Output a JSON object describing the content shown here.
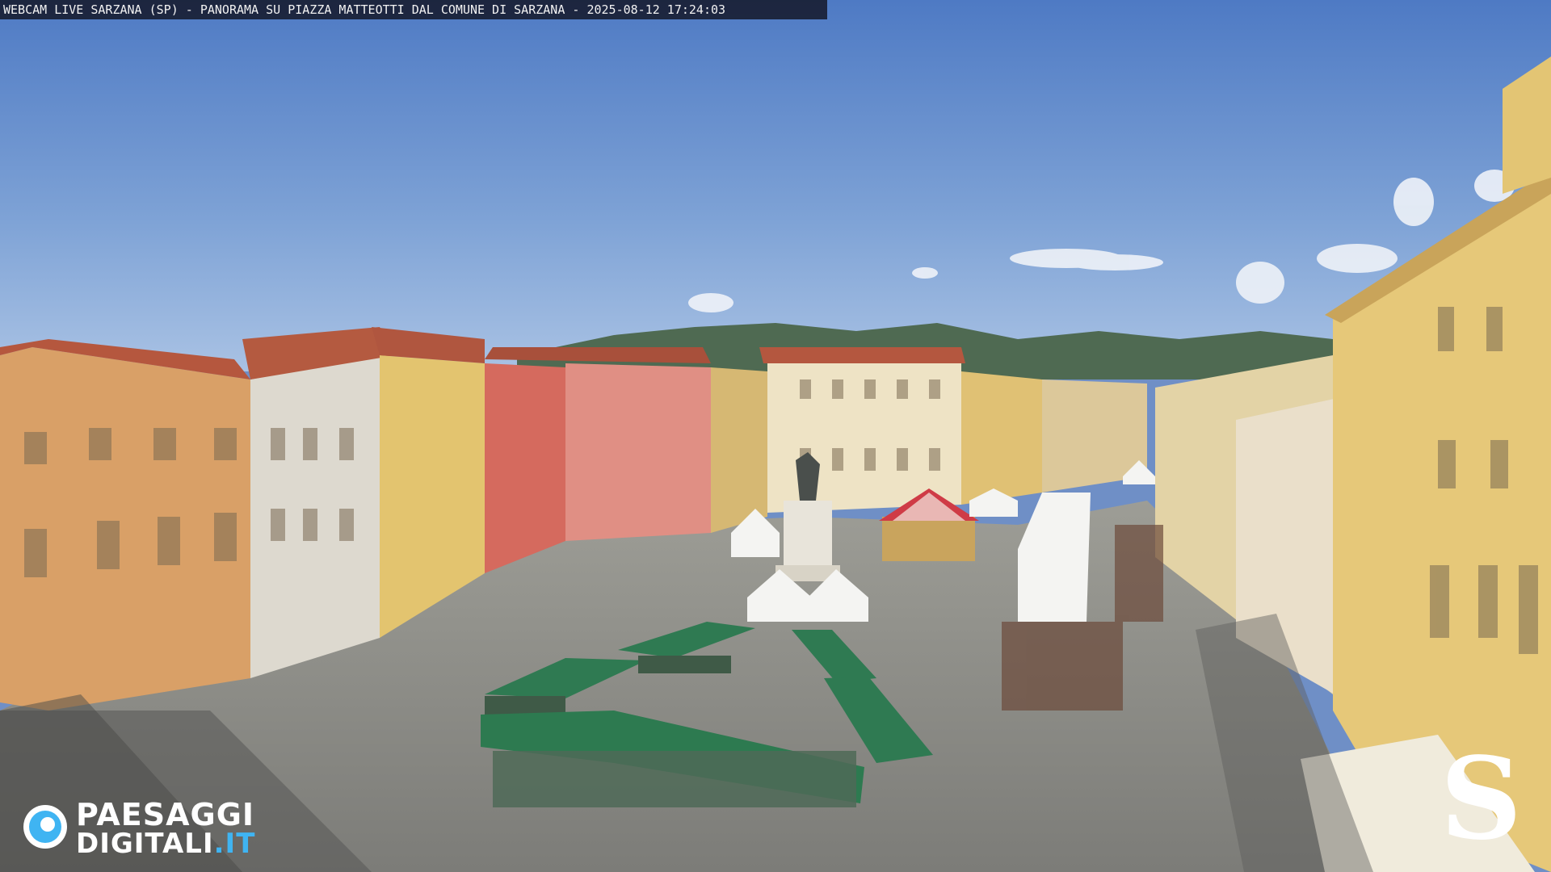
{
  "overlay": {
    "caption": "WEBCAM LIVE SARZANA (SP) - PANORAMA SU PIAZZA MATTEOTTI DAL COMUNE DI SARZANA - 2025-08-12  17:24:03"
  },
  "branding": {
    "name_line1": "PAESAGGI",
    "name_line2": "DIGITALI",
    "name_suffix": ".IT",
    "logo_icon": "eye-icon",
    "corner_mark": "S"
  },
  "colors": {
    "sky": "#5c86c9",
    "pavement": "#8a8b86",
    "stall_green": "#2f7a52",
    "brand_blue": "#3fb4f2"
  }
}
